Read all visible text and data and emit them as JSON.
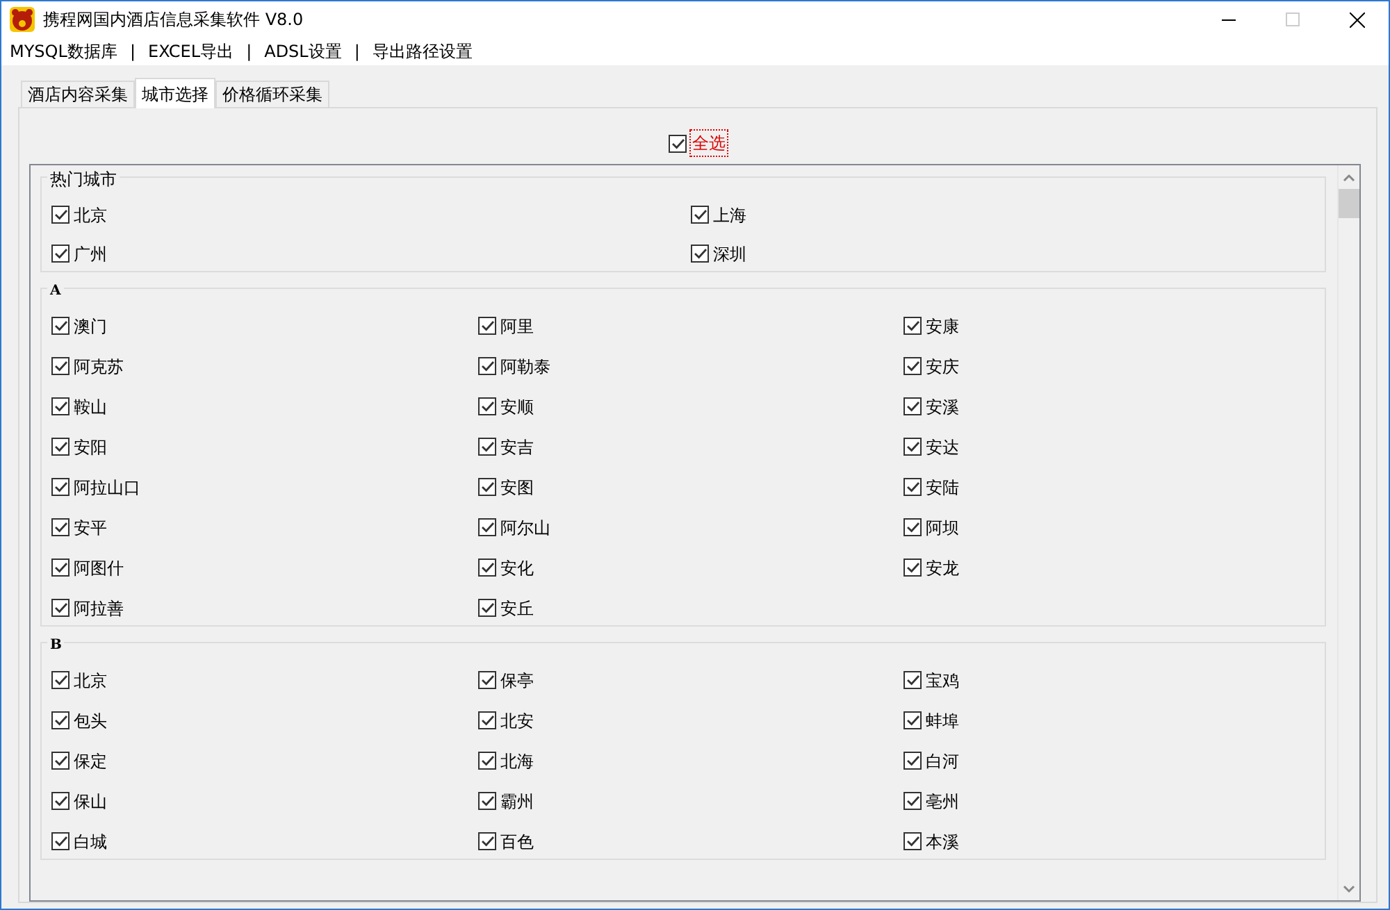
{
  "window": {
    "title": "携程网国内酒店信息采集软件 V8.0"
  },
  "menu": [
    {
      "label": "MYSQL数据库"
    },
    {
      "label": "|"
    },
    {
      "label": "EXCEL导出"
    },
    {
      "label": "|"
    },
    {
      "label": "ADSL设置"
    },
    {
      "label": "|"
    },
    {
      "label": "导出路径设置"
    }
  ],
  "tabs": [
    {
      "label": "酒店内容采集",
      "selected": false
    },
    {
      "label": "城市选择",
      "selected": true
    },
    {
      "label": "价格循环采集",
      "selected": false
    }
  ],
  "select_all": {
    "label": "全选",
    "checked": true
  },
  "groups": [
    {
      "title": "热门城市",
      "kind": "two-column",
      "items": [
        {
          "label": "北京",
          "checked": true
        },
        {
          "label": "上海",
          "checked": true
        },
        {
          "label": "广州",
          "checked": true
        },
        {
          "label": "深圳",
          "checked": true
        }
      ]
    },
    {
      "title": "A",
      "kind": "three-column",
      "items": [
        {
          "label": "澳门",
          "checked": true
        },
        {
          "label": "阿里",
          "checked": true
        },
        {
          "label": "安康",
          "checked": true
        },
        {
          "label": "阿克苏",
          "checked": true
        },
        {
          "label": "阿勒泰",
          "checked": true
        },
        {
          "label": "安庆",
          "checked": true
        },
        {
          "label": "鞍山",
          "checked": true
        },
        {
          "label": "安顺",
          "checked": true
        },
        {
          "label": "安溪",
          "checked": true
        },
        {
          "label": "安阳",
          "checked": true
        },
        {
          "label": "安吉",
          "checked": true
        },
        {
          "label": "安达",
          "checked": true
        },
        {
          "label": "阿拉山口",
          "checked": true
        },
        {
          "label": "安图",
          "checked": true
        },
        {
          "label": "安陆",
          "checked": true
        },
        {
          "label": "安平",
          "checked": true
        },
        {
          "label": "阿尔山",
          "checked": true
        },
        {
          "label": "阿坝",
          "checked": true
        },
        {
          "label": "阿图什",
          "checked": true
        },
        {
          "label": "安化",
          "checked": true
        },
        {
          "label": "安龙",
          "checked": true
        },
        {
          "label": "阿拉善",
          "checked": true
        },
        {
          "label": "安丘",
          "checked": true
        }
      ]
    },
    {
      "title": "B",
      "kind": "three-column",
      "items": [
        {
          "label": "北京",
          "checked": true
        },
        {
          "label": "保亭",
          "checked": true
        },
        {
          "label": "宝鸡",
          "checked": true
        },
        {
          "label": "包头",
          "checked": true
        },
        {
          "label": "北安",
          "checked": true
        },
        {
          "label": "蚌埠",
          "checked": true
        },
        {
          "label": "保定",
          "checked": true
        },
        {
          "label": "北海",
          "checked": true
        },
        {
          "label": "白河",
          "checked": true
        },
        {
          "label": "保山",
          "checked": true
        },
        {
          "label": "霸州",
          "checked": true
        },
        {
          "label": "亳州",
          "checked": true
        },
        {
          "label": "白城",
          "checked": true
        },
        {
          "label": "百色",
          "checked": true
        },
        {
          "label": "本溪",
          "checked": true
        }
      ]
    }
  ]
}
